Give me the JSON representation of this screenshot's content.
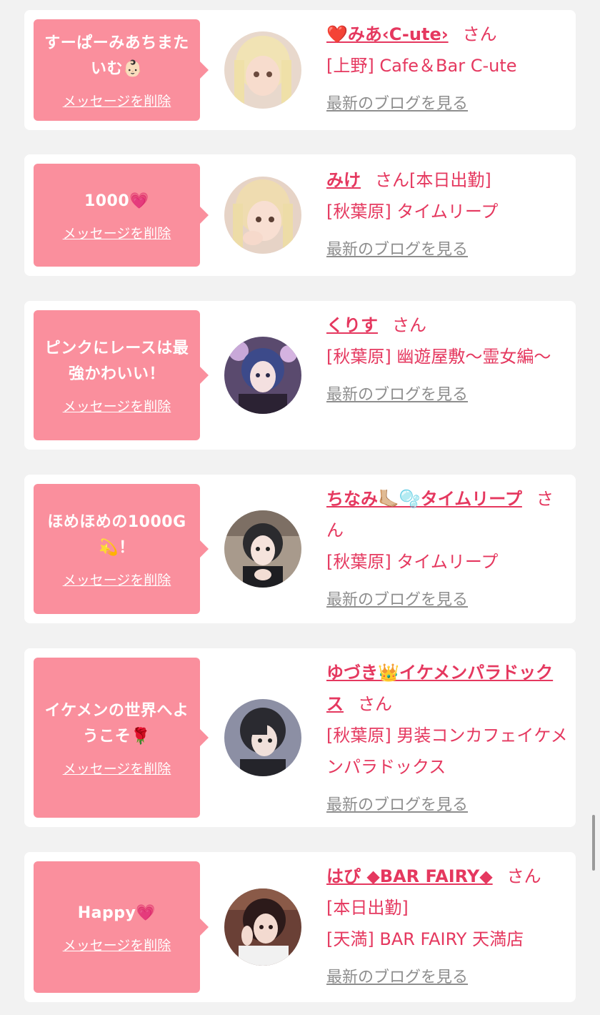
{
  "delete_label": "メッセージを削除",
  "blog_label": "最新のブログを見る",
  "san_label": "さん",
  "cards": [
    {
      "message": "すーぱーみあちまたいむ👶🏻",
      "name": "❤️みあ‹C-ute›",
      "lines": [
        "[上野] Cafe＆Bar C-ute"
      ]
    },
    {
      "message": "1000💗",
      "name": "みけ",
      "name_suffix": "[本日出勤]",
      "lines": [
        "[秋葉原] タイムリープ"
      ]
    },
    {
      "message": "ピンクにレースは最強かわいい！",
      "name": "くりす",
      "lines": [
        "[秋葉原] 幽遊屋敷～霊女編～"
      ]
    },
    {
      "message": "ほめほめの1000G💫！",
      "name": "ちなみ🦶🏼🫧タイムリープ",
      "lines": [
        "[秋葉原] タイムリープ"
      ]
    },
    {
      "message": "イケメンの世界へようこそ🌹",
      "name": "ゆづき👑イケメンパラドックス",
      "lines": [
        "[秋葉原] 男装コンカフェイケメンパラドックス"
      ]
    },
    {
      "message": "Happy💗",
      "name": "はぴ ◆BAR FAIRY◆",
      "lines": [
        "[本日出勤]",
        "[天満] BAR FAIRY 天満店"
      ]
    }
  ],
  "colors": {
    "bubble": "#fa8f9d",
    "accent": "#e5385f",
    "blog_link": "#8e8e8e",
    "background": "#f2f2f2"
  }
}
